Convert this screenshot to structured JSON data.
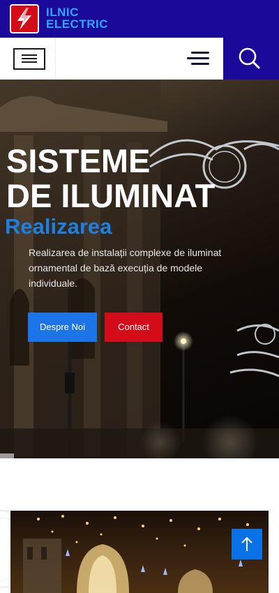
{
  "brand": {
    "line1": "ILNIC",
    "line2": "ELECTRIC"
  },
  "navbar": {
    "menu_icon": "hamburger-box-icon",
    "toggle_icon": "hamburger-icon",
    "search_icon": "search-icon"
  },
  "hero": {
    "title_line1": "SISTEME",
    "title_line2": "DE ILUMINAT",
    "subtitle": "Realizarea",
    "description": "Realizarea de instalații complexe de iluminat ornamental de bază execuția de modele individuale.",
    "buttons": {
      "about": "Despre Noi",
      "contact": "Contact"
    }
  },
  "back_to_top_icon": "arrow-up-icon",
  "colors": {
    "brand_blue": "#1b0a9a",
    "accent_blue": "#1b74e8",
    "accent_red": "#d40c1a",
    "logo_text": "#2ca8ff"
  }
}
